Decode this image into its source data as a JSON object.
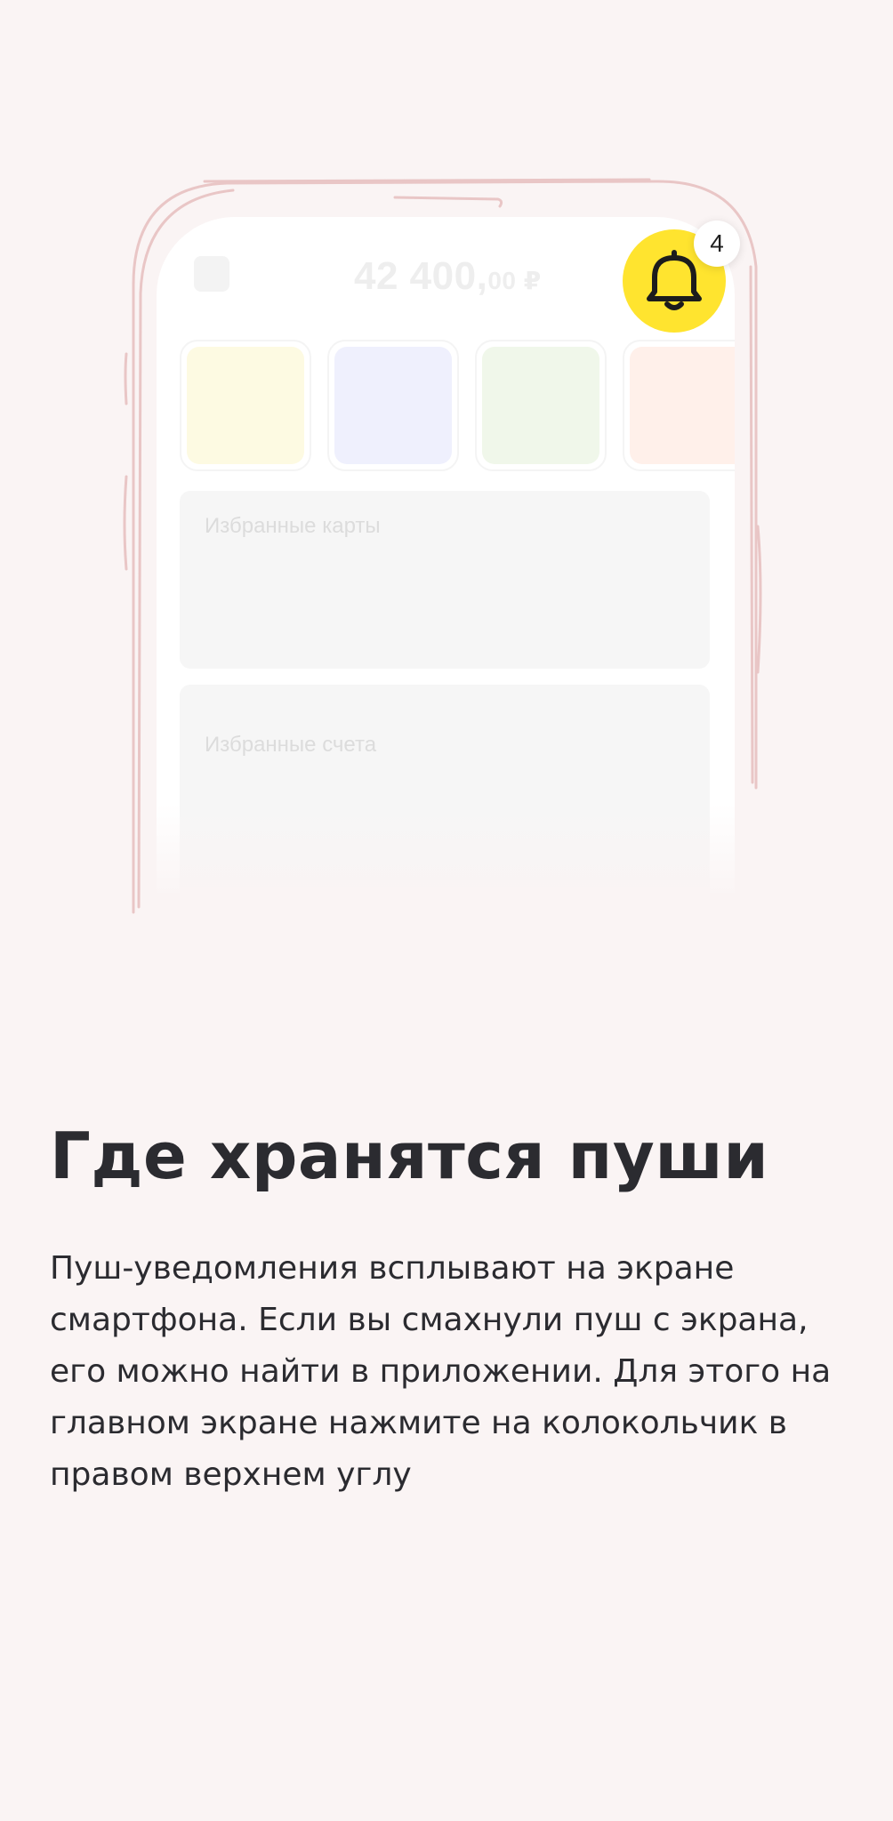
{
  "illustration": {
    "balance_main": "42 400,",
    "balance_kop": "00 ₽",
    "tiles": [
      {
        "color": "#fdfae2"
      },
      {
        "color": "#eff0fd"
      },
      {
        "color": "#f0f7ea"
      },
      {
        "color": "#fff0ea"
      }
    ],
    "panels": {
      "cards_label": "Избранные карты",
      "accounts_label": "Избранные счета"
    },
    "bell": {
      "icon": "bell-icon",
      "badge_count": "4",
      "accent_color": "#ffe42f"
    }
  },
  "content": {
    "title": "Где хранятся пуши",
    "body": "Пуш-уведомления всплывают на экране смартфона. Если вы смахнули пуш с экрана, его можно найти в приложении. Для этого на главном экране нажмите на колокольчик в правом верхнем углу"
  }
}
